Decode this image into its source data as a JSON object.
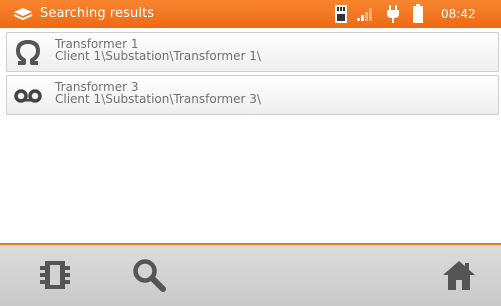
{
  "header": {
    "title": "Searching results",
    "time": "08:42",
    "icons": [
      "brand-logo-icon",
      "sd-card-icon",
      "signal-icon",
      "plug-icon",
      "battery-icon"
    ],
    "color": "#f07a2a"
  },
  "results": [
    {
      "icon": "omega-icon",
      "name": "Transformer 1",
      "path": "Client 1\\Substation\\Transformer 1\\"
    },
    {
      "icon": "tape-icon",
      "name": "Transformer 3",
      "path": "Client 1\\Substation\\Transformer 3\\"
    }
  ],
  "toolbar": {
    "buttons": [
      "device-icon",
      "search-icon",
      "home-icon"
    ]
  }
}
